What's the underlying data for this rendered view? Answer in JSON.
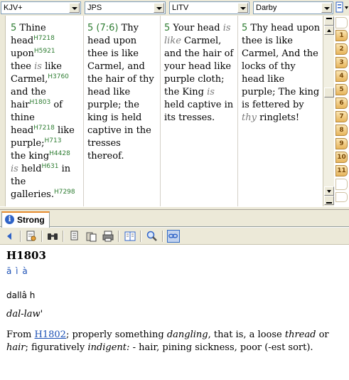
{
  "versions": [
    "KJV+",
    "JPS",
    "LITV",
    "Darby"
  ],
  "columns": {
    "kjv": {
      "verse": "5",
      "w": {
        "thine": "Thine",
        "head": "head",
        "s_head": "H7218",
        "upon": "upon",
        "s_upon": "H5921",
        "thee": "thee",
        "is": "is",
        "like": "like",
        "carmel": "Carmel,",
        "s_carmel": "H3760",
        "and_the": "and the",
        "hair": "hair",
        "s_hair": "H1803",
        "of": "of",
        "thine2": "thine",
        "head2": "head",
        "s_head2": "H7218",
        "like2": "like",
        "purple": "purple;",
        "s_purple": "H713",
        "the_king": "the king",
        "s_king": "H4428",
        "is2": "is",
        "held": "held",
        "s_held": "H631",
        "in_the": "in the",
        "galleries": "galleries.",
        "s_galleries": "H7298"
      }
    },
    "jps": {
      "verse": "5",
      "ref": "(7:6)",
      "text": "Thy head upon thee is like Carmel, and the hair of thy head like purple; the king is held captive in the tresses thereof."
    },
    "litv": {
      "verse": "5",
      "pre": "Your head",
      "italic1": "is like",
      "mid": "Carmel, and the hair of your head like purple cloth; the King",
      "italic2": "is",
      "post": "held captive in its tresses."
    },
    "darby": {
      "verse": "5",
      "pre": "Thy head upon thee is like Carmel, And the locks of thy head like purple; The king is fettered by",
      "italic": "thy",
      "post": "ringlets!"
    }
  },
  "chapter_tabs": [
    "1",
    "2",
    "3",
    "4",
    "5",
    "6",
    "7",
    "8",
    "9",
    "10",
    "11"
  ],
  "strong": {
    "tab_label": "Strong",
    "number": "H1803",
    "hebrew": "ā ì à",
    "translit": "dallâ  h",
    "pronunciation": "dal-law'",
    "def": {
      "from": "From",
      "link": "H1802",
      "t1": "; properly something",
      "dangling": "dangling",
      "t2": ", that is, a loose",
      "thread": "thread",
      "t3": "or",
      "hair": "hair",
      "t4": "; figuratively",
      "indigent": "indigent:",
      "t5": "- hair, pining sickness, poor (-est sort)."
    }
  },
  "toolbar_icons": [
    "back-arrow-icon",
    "sync-icon",
    "binoculars-icon",
    "copy-icon",
    "paste-icon",
    "print-icon",
    "book-icon",
    "zoom-icon",
    "link-icon"
  ]
}
